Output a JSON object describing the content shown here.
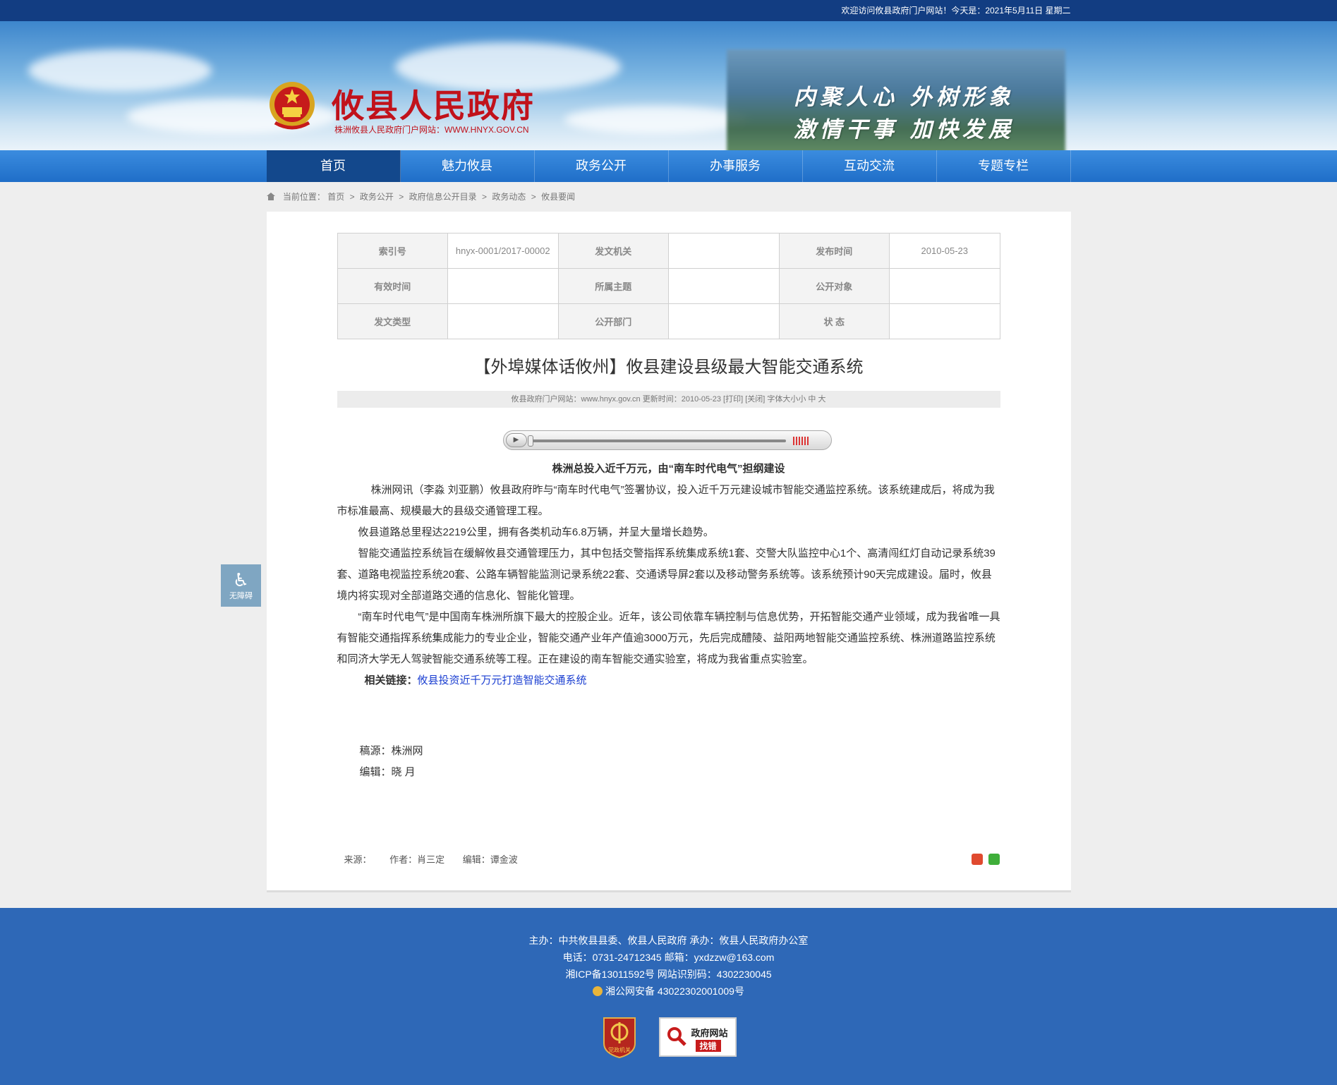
{
  "topbar": {
    "welcome": "欢迎访问攸县政府门户网站！今天是：2021年5月11日 星期二"
  },
  "header": {
    "title": "攸县人民政府",
    "subtitle": "株洲攸县人民政府门户网站：WWW.HNYX.GOV.CN",
    "slogan_line1": "内聚人心  外树形象",
    "slogan_line2": "激情干事  加快发展"
  },
  "nav": {
    "items": [
      {
        "label": "首页"
      },
      {
        "label": "魅力攸县"
      },
      {
        "label": "政务公开"
      },
      {
        "label": "办事服务"
      },
      {
        "label": "互动交流"
      },
      {
        "label": "专题专栏"
      }
    ]
  },
  "breadcrumb": {
    "prefix": "当前位置：",
    "items": [
      "首页",
      "政务公开",
      "政府信息公开目录",
      "政务动态",
      "攸县要闻"
    ],
    "sep": ">"
  },
  "meta": {
    "index_label": "索引号",
    "index_value": "hnyx-0001/2017-00002",
    "issuer_label": "发文机关",
    "issuer_value": "",
    "date_label": "发布时间",
    "date_value": "2010-05-23",
    "valid_label": "有效时间",
    "valid_value": "",
    "topic_label": "所属主题",
    "topic_value": "",
    "audience_label": "公开对象",
    "audience_value": "",
    "doc_type_label": "发文类型",
    "doc_type_value": "",
    "dept_label": "公开部门",
    "dept_value": "",
    "status_label": "状 态",
    "status_value": ""
  },
  "article": {
    "title": "【外埠媒体话攸州】攸县建设县级最大智能交通系统",
    "info": "攸县政府门户网站：www.hnyx.gov.cn   更新时间：2010-05-23  [打印]  [关闭]   字体大小小 中 大",
    "subtitle": "株洲总投入近千万元，由“南车时代电气”担纲建设",
    "p1": "株洲网讯（李淼 刘亚鹏）攸县政府昨与“南车时代电气”签署协议，投入近千万元建设城市智能交通监控系统。该系统建成后，将成为我市标准最高、规模最大的县级交通管理工程。",
    "p2": "攸县道路总里程达2219公里，拥有各类机动车6.8万辆，并呈大量增长趋势。",
    "p3": "智能交通监控系统旨在缓解攸县交通管理压力，其中包括交警指挥系统集成系统1套、交警大队监控中心1个、高清闯红灯自动记录系统39套、道路电视监控系统20套、公路车辆智能监测记录系统22套、交通诱导屏2套以及移动警务系统等。该系统预计90天完成建设。届时，攸县境内将实现对全部道路交通的信息化、智能化管理。",
    "p4": "“南车时代电气”是中国南车株洲所旗下最大的控股企业。近年，该公司依靠车辆控制与信息优势，开拓智能交通产业领域，成为我省唯一具有智能交通指挥系统集成能力的专业企业，智能交通产业年产值逾3000万元，先后完成醴陵、益阳两地智能交通监控系统、株洲道路监控系统和同济大学无人驾驶智能交通系统等工程。正在建设的南车智能交通实验室，将成为我省重点实验室。",
    "related_label": "相关链接：",
    "related_link": "攸县投资近千万元打造智能交通系统",
    "source_line": "稿源：株洲网",
    "editor_line": "编辑：晓 月"
  },
  "article_footer": {
    "source": "来源：",
    "author": "作者：肖三定",
    "editor": "编辑：谭金波"
  },
  "accessibility": {
    "label": "无障碍"
  },
  "footer": {
    "line1": "主办：中共攸县县委、攸县人民政府 承办：攸县人民政府办公室",
    "line2": "电话：0731-24712345  邮箱：yxdzzw@163.com",
    "line3": "湘ICP备13011592号    网站识别码：4302230045",
    "line4": "湘公网安备 43022302001009号",
    "badge1": "党政机关",
    "badge2_top": "政府网站",
    "badge2_bottom": "找错"
  },
  "colors": {
    "topbar": "#123d82",
    "nav": "#1f6ec8",
    "nav_active": "#13488c",
    "footer": "#2e68b7",
    "title_red": "#c1121b"
  }
}
